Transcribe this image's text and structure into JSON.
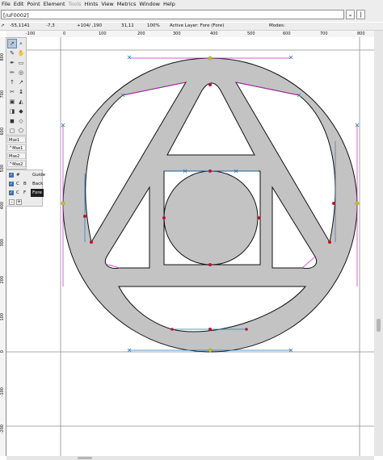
{
  "menubar": {
    "items": [
      "File",
      "Edit",
      "Point",
      "Element",
      "Tools",
      "Hints",
      "View",
      "Metrics",
      "Window",
      "Help"
    ],
    "disabled": [
      "Tools"
    ]
  },
  "glyphbar": {
    "glyph_name": "[/uF0002]",
    "dropdown_glyph": "⌄",
    "next_glyph": "|"
  },
  "infobar": {
    "pos1": "-55,1141",
    "pos2": "-7,3",
    "pos3": "+104/ ,190",
    "pos4": "31,11",
    "zoom": "100%",
    "active_layer": "Active Layer: Fore (Fore)",
    "modes": "Modes:"
  },
  "ruler": {
    "h_ticks": [
      "-100",
      "0",
      "100",
      "200",
      "300",
      "400",
      "500",
      "600",
      "700",
      "800"
    ],
    "v_ticks": [
      "800",
      "700",
      "600",
      "500",
      "400",
      "300",
      "200",
      "100",
      "0",
      "-100",
      "-200"
    ]
  },
  "toolbox": {
    "tools": [
      "pointer-icon",
      "magnify-icon",
      "freehand-icon",
      "scroll-icon",
      "pen-icon",
      "spiro-icon",
      "curve-point-icon",
      "hv-curve-point-icon",
      "corner-point-icon",
      "tangent-point-icon",
      "knife-icon",
      "ruler-icon",
      "scale-icon",
      "rotate-icon",
      "flip-icon",
      "skew-icon",
      "rotate-3d-icon",
      "perspective-icon",
      "rectangle-icon",
      "polygon-icon"
    ]
  },
  "cv_layers": {
    "items": [
      "Mse1",
      "^Mse1",
      "Mse2",
      "^Mse2"
    ]
  },
  "layers": {
    "rows": [
      {
        "type": "#",
        "type2": "",
        "name": "Guide",
        "selected": false
      },
      {
        "type": "C",
        "type2": "B",
        "name": "Back",
        "selected": false
      },
      {
        "type": "C",
        "type2": "F",
        "name": "Fore",
        "selected": true
      }
    ],
    "add_label": "+",
    "remove_label": "-"
  },
  "colors": {
    "fill": "#c3c3c3",
    "outline": "#111111",
    "handle_magenta": "#d020d0",
    "handle_cyan": "#2878b8",
    "point_red": "#c0102a",
    "guide": "#8e8e8e"
  }
}
